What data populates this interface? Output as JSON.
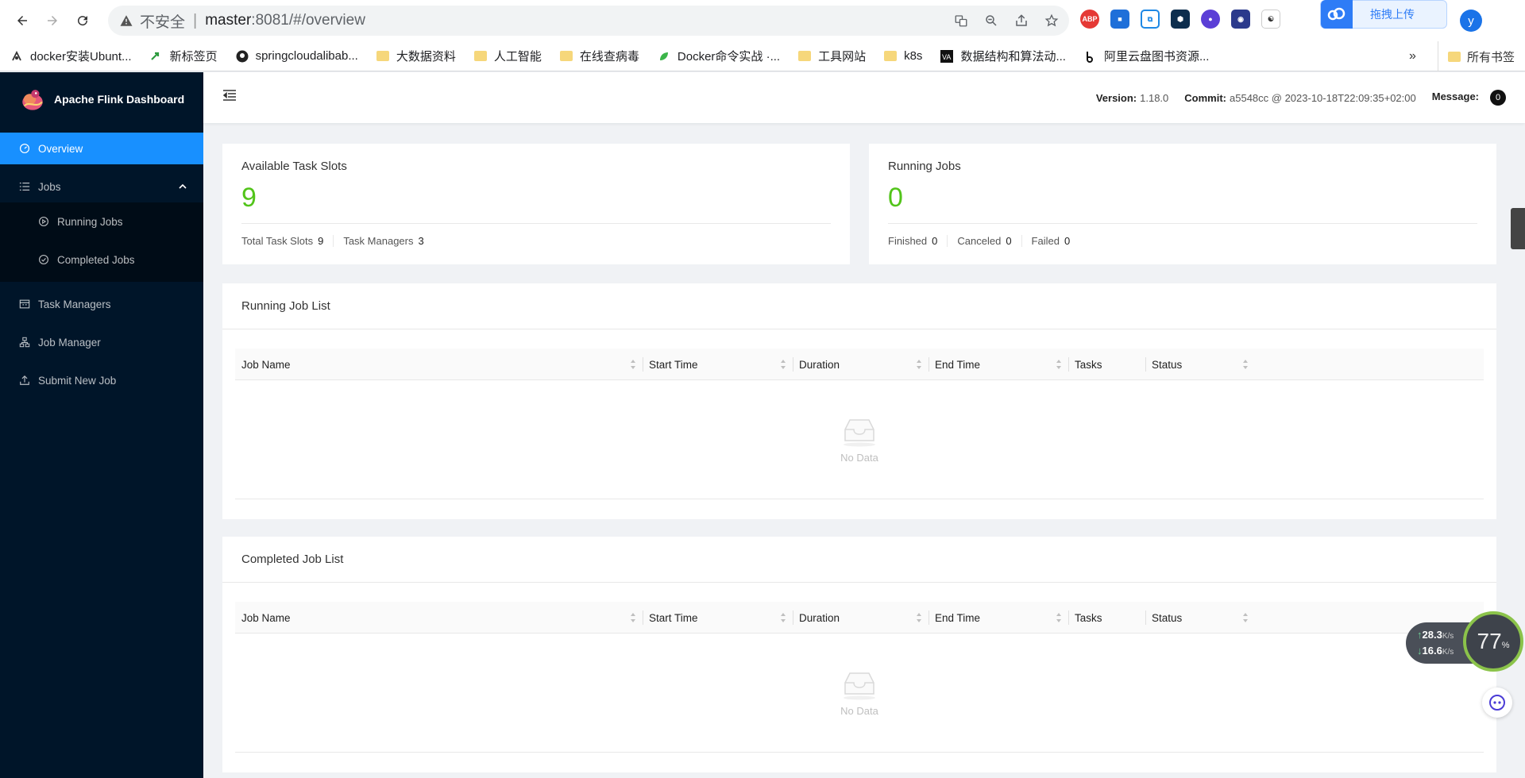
{
  "browser": {
    "insecure_label": "不安全",
    "url_host": "master",
    "url_rest": ":8081/#/overview",
    "upload_label": "拖拽上传",
    "profile_initial": "y",
    "bookmarks": [
      {
        "label": "docker安装Ubunt...",
        "icon": "link-icon"
      },
      {
        "label": "新标签页",
        "icon": "arrow-icon"
      },
      {
        "label": "springcloudalibab...",
        "icon": "github-icon"
      },
      {
        "label": "大数据资料",
        "icon": "folder-icon"
      },
      {
        "label": "人工智能",
        "icon": "folder-icon"
      },
      {
        "label": "在线查病毒",
        "icon": "folder-icon"
      },
      {
        "label": "Docker命令实战 ·...",
        "icon": "leaf-icon"
      },
      {
        "label": "工具网站",
        "icon": "folder-icon"
      },
      {
        "label": "k8s",
        "icon": "folder-icon"
      },
      {
        "label": "数据结构和算法动...",
        "icon": "va-icon"
      },
      {
        "label": "阿里云盘图书资源...",
        "icon": "b-icon"
      }
    ],
    "more_label": "»",
    "all_bookmarks_label": "所有书签"
  },
  "app": {
    "title": "Apache Flink Dashboard",
    "menu": {
      "overview": "Overview",
      "jobs": "Jobs",
      "running_jobs": "Running Jobs",
      "completed_jobs": "Completed Jobs",
      "task_managers": "Task Managers",
      "job_manager": "Job Manager",
      "submit_new_job": "Submit New Job"
    },
    "header": {
      "version_label": "Version:",
      "version_value": "1.18.0",
      "commit_label": "Commit:",
      "commit_value": "a5548cc @ 2023-10-18T22:09:35+02:00",
      "message_label": "Message:",
      "message_count": "0"
    },
    "slots_card": {
      "title": "Available Task Slots",
      "value": "9",
      "total_label": "Total Task Slots",
      "total_value": "9",
      "tm_label": "Task Managers",
      "tm_value": "3"
    },
    "jobs_card": {
      "title": "Running Jobs",
      "value": "0",
      "finished_label": "Finished",
      "finished_value": "0",
      "canceled_label": "Canceled",
      "canceled_value": "0",
      "failed_label": "Failed",
      "failed_value": "0"
    },
    "running_list": {
      "title": "Running Job List",
      "columns": [
        "Job Name",
        "Start Time",
        "Duration",
        "End Time",
        "Tasks",
        "Status"
      ],
      "empty_text": "No Data"
    },
    "completed_list": {
      "title": "Completed Job List",
      "columns": [
        "Job Name",
        "Start Time",
        "Duration",
        "End Time",
        "Tasks",
        "Status"
      ],
      "empty_text": "No Data"
    }
  },
  "widget": {
    "up_speed": "28.3",
    "down_speed": "16.6",
    "speed_unit": "K/s",
    "percent": "77",
    "percent_unit": "%"
  },
  "colors": {
    "accent": "#1890ff",
    "sidebar_bg": "#001529",
    "success": "#52c41a"
  }
}
